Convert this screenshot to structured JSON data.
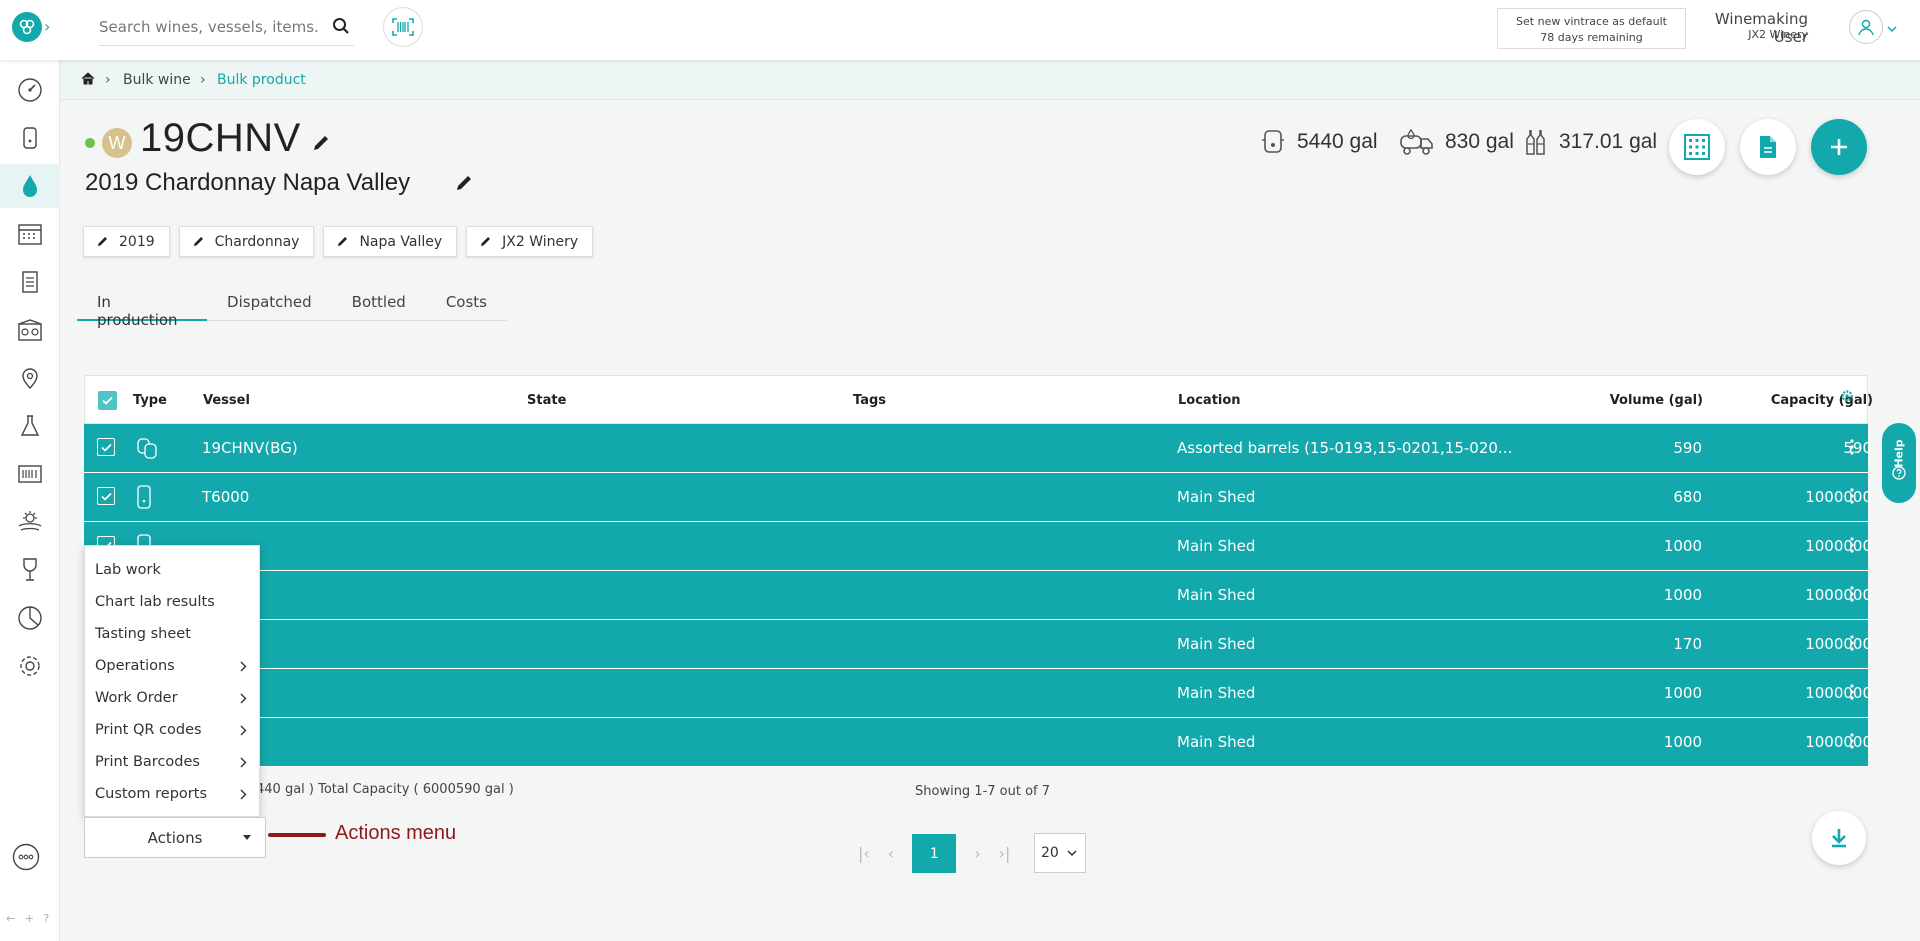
{
  "topbar": {
    "search_placeholder": "Search wines, vessels, items...",
    "vintrace_line1": "Set new vintrace as default",
    "vintrace_line2": "78 days remaining",
    "user_name": "Winemaking User",
    "user_winery": "JX2 Winery"
  },
  "sidebar": {
    "items": [
      "dashboard-icon",
      "vessel-icon",
      "bulk-wine-icon",
      "calendar-icon",
      "work-order-icon",
      "winery-icon",
      "location-icon",
      "lab-icon",
      "barcode-reader-icon",
      "vineyard-icon",
      "wine-glass-icon",
      "reports-icon",
      "settings-icon"
    ],
    "footer": "← + ?"
  },
  "breadcrumb": {
    "level1": "Bulk wine",
    "level2": "Bulk product"
  },
  "product": {
    "color_badge": "W",
    "code": "19CHNV",
    "name": "2019 Chardonnay Napa Valley",
    "status_color": "#6cc24a"
  },
  "stats": {
    "in_vessel": "5440 gal",
    "in_transit": "830 gal",
    "bottled": "317.01 gal"
  },
  "chips": [
    "2019",
    "Chardonnay",
    "Napa Valley",
    "JX2 Winery"
  ],
  "tabs": [
    "In production",
    "Dispatched",
    "Bottled",
    "Costs"
  ],
  "table": {
    "headers": {
      "type": "Type",
      "vessel": "Vessel",
      "state": "State",
      "tags": "Tags",
      "location": "Location",
      "volume": "Volume (gal)",
      "capacity": "Capacity (gal)"
    },
    "rows": [
      {
        "vessel": "19CHNV(BG)",
        "location": "Assorted barrels (15-0193,15-0201,15-020...",
        "volume": "590",
        "capacity": "590",
        "type": "barrel-group-icon"
      },
      {
        "vessel": "T6000",
        "location": "Main Shed",
        "volume": "680",
        "capacity": "1000000",
        "type": "tank-icon"
      },
      {
        "vessel": "",
        "location": "Main Shed",
        "volume": "1000",
        "capacity": "1000000",
        "type": "tank-icon"
      },
      {
        "vessel": "",
        "location": "Main Shed",
        "volume": "1000",
        "capacity": "1000000",
        "type": "tank-icon"
      },
      {
        "vessel": "",
        "location": "Main Shed",
        "volume": "170",
        "capacity": "1000000",
        "type": "tank-icon"
      },
      {
        "vessel": "",
        "location": "Main Shed",
        "volume": "1000",
        "capacity": "1000000",
        "type": "tank-icon"
      },
      {
        "vessel": "",
        "location": "Main Shed",
        "volume": "1000",
        "capacity": "1000000",
        "type": "tank-icon"
      }
    ],
    "totals_text": "440 gal ) Total Capacity ( 6000590 gal )",
    "showing_text": "Showing 1-7 out of 7"
  },
  "pagination": {
    "current_page": "1",
    "per_page": "20"
  },
  "actions_menu": {
    "items": [
      {
        "label": "Lab work",
        "submenu": false
      },
      {
        "label": "Chart lab results",
        "submenu": false
      },
      {
        "label": "Tasting sheet",
        "submenu": false
      },
      {
        "label": "Operations",
        "submenu": true
      },
      {
        "label": "Work Order",
        "submenu": true
      },
      {
        "label": "Print QR codes",
        "submenu": true
      },
      {
        "label": "Print Barcodes",
        "submenu": true
      },
      {
        "label": "Custom reports",
        "submenu": true
      }
    ],
    "button_label": "Actions"
  },
  "annotation": {
    "callout_text": "Actions menu",
    "color": "#8b1a1a"
  },
  "help": {
    "label": "Help"
  },
  "colors": {
    "accent": "#13a8ab"
  }
}
